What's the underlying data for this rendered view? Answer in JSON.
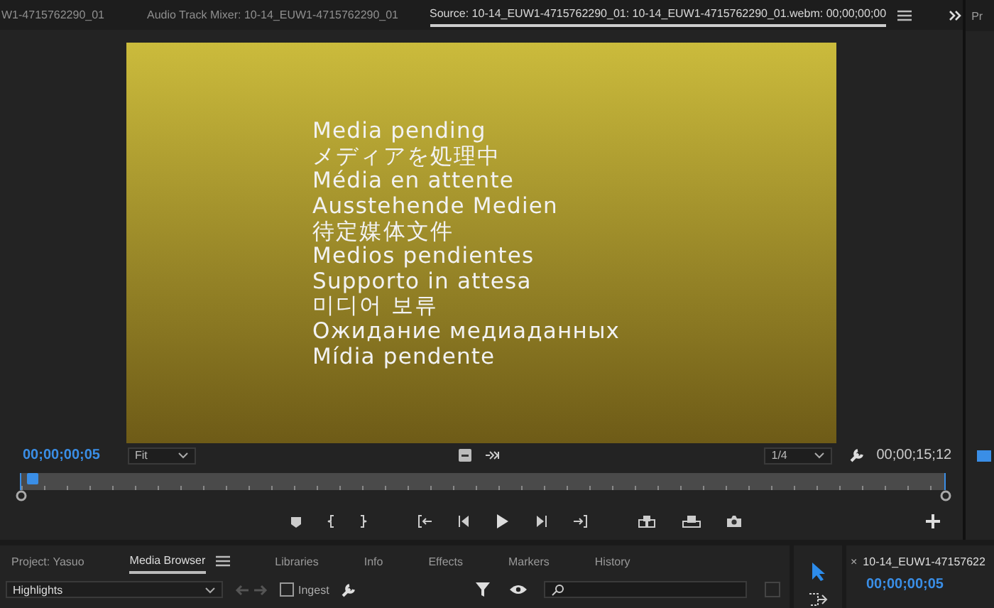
{
  "tabs": [
    {
      "label": "W1-4715762290_01",
      "selected": false
    },
    {
      "label": "Audio Track Mixer: 10-14_EUW1-4715762290_01",
      "selected": false
    },
    {
      "label": "Source: 10-14_EUW1-4715762290_01: 10-14_EUW1-4715762290_01.webm: 00;00;00;00",
      "selected": true
    }
  ],
  "next_panel_tab": "Pr",
  "slate_lines": [
    "Media pending",
    "メディアを処理中",
    "Média en attente",
    "Ausstehende Medien",
    "待定媒体文件",
    "Medios pendientes",
    "Supporto in attesa",
    "미디어 보류",
    "Ожидание медиаданных",
    "Mídia pendente"
  ],
  "monitor": {
    "current_time": "00;00;00;05",
    "zoom": "Fit",
    "resolution": "1/4",
    "duration": "00;00;15;12",
    "playhead": {
      "level": 0.005
    }
  },
  "bottom_tabs": [
    {
      "label": "Project: Yasuo",
      "selected": false
    },
    {
      "label": "Media Browser",
      "selected": true
    },
    {
      "label": "Libraries",
      "selected": false
    },
    {
      "label": "Info",
      "selected": false
    },
    {
      "label": "Effects",
      "selected": false
    },
    {
      "label": "Markers",
      "selected": false
    },
    {
      "label": "History",
      "selected": false
    }
  ],
  "browser": {
    "location": "Highlights",
    "ingest": {
      "label": "Ingest",
      "checked": false
    }
  },
  "timeline": {
    "close": "×",
    "tab": "10-14_EUW1-47157622",
    "current_time": "00;00;00;05"
  }
}
